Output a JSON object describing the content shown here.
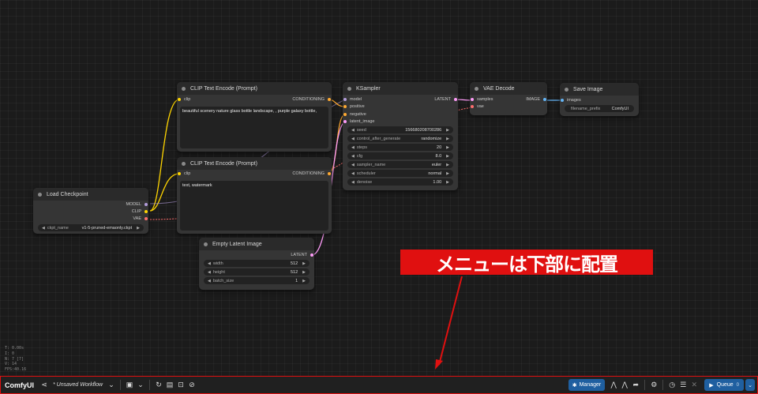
{
  "nodes": {
    "clip_pos": {
      "title": "CLIP Text Encode (Prompt)",
      "input": "clip",
      "output": "CONDITIONING",
      "text": "beautiful scenery nature glass bottle landscape, , purple galaxy bottle,"
    },
    "clip_neg": {
      "title": "CLIP Text Encode (Prompt)",
      "input": "clip",
      "output": "CONDITIONING",
      "text": "text, watermark"
    },
    "checkpoint": {
      "title": "Load Checkpoint",
      "outputs": [
        "MODEL",
        "CLIP",
        "VAE"
      ],
      "widget_label": "ckpt_name",
      "widget_value": "v1-5-pruned-emaonly.ckpt"
    },
    "latent": {
      "title": "Empty Latent Image",
      "output": "LATENT",
      "widgets": [
        {
          "label": "width",
          "value": "512"
        },
        {
          "label": "height",
          "value": "512"
        },
        {
          "label": "batch_size",
          "value": "1"
        }
      ]
    },
    "ksampler": {
      "title": "KSampler",
      "inputs": [
        "model",
        "positive",
        "negative",
        "latent_image"
      ],
      "output": "LATENT",
      "widgets": [
        {
          "label": "seed",
          "value": "156680208700286"
        },
        {
          "label": "control_after_generate",
          "value": "randomize"
        },
        {
          "label": "steps",
          "value": "20"
        },
        {
          "label": "cfg",
          "value": "8.0"
        },
        {
          "label": "sampler_name",
          "value": "euler"
        },
        {
          "label": "scheduler",
          "value": "normal"
        },
        {
          "label": "denoise",
          "value": "1.00"
        }
      ]
    },
    "vae_decode": {
      "title": "VAE Decode",
      "inputs": [
        "samples",
        "vae"
      ],
      "output": "IMAGE"
    },
    "save_image": {
      "title": "Save Image",
      "input": "images",
      "widget_label": "filename_prefix",
      "widget_value": "ComfyUI"
    }
  },
  "stats": [
    "T: 0.00s",
    "I: 0",
    "N: 7 [7]",
    "V: 14",
    "FPS:40.16"
  ],
  "annotation": "メニューは下部に配置",
  "menubar": {
    "logo": "ComfyUI",
    "workflow": "* Unsaved Workflow",
    "manager": "Manager",
    "queue": "Queue",
    "queue_count": "0"
  },
  "colors": {
    "model": "#b39ddb",
    "clip": "#ffd500",
    "vae": "#ff6e6e",
    "conditioning": "#ffa931",
    "latent": "#ff9cf9",
    "image": "#64b5f6",
    "accent": "#1f5fa0",
    "annotation": "#e01010"
  }
}
